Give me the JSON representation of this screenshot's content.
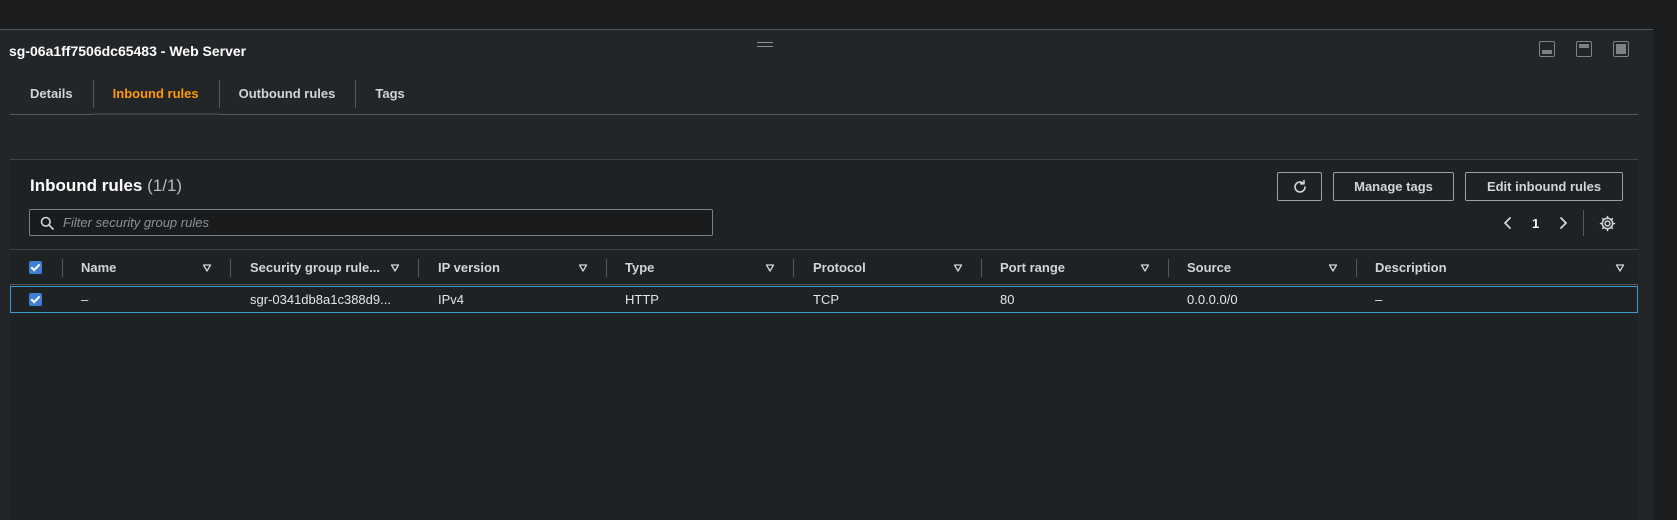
{
  "page": {
    "security_group_title": "sg-06a1ff7506dc65483 - Web Server"
  },
  "tabs": [
    {
      "label": "Details",
      "active": false
    },
    {
      "label": "Inbound rules",
      "active": true
    },
    {
      "label": "Outbound rules",
      "active": false
    },
    {
      "label": "Tags",
      "active": false
    }
  ],
  "inbound": {
    "title": "Inbound rules",
    "count": "(1/1)",
    "buttons": {
      "manage_tags": "Manage tags",
      "edit_inbound_rules": "Edit inbound rules"
    },
    "filter": {
      "placeholder": "Filter security group rules",
      "value": ""
    },
    "pagination": {
      "current_page": "1"
    },
    "table": {
      "headers": [
        "Name",
        "Security group rule...",
        "IP version",
        "Type",
        "Protocol",
        "Port range",
        "Source",
        "Description"
      ],
      "rows": [
        {
          "selected": true,
          "name": "–",
          "rule_id": "sgr-0341db8a1c388d9...",
          "ip_version": "IPv4",
          "type": "HTTP",
          "protocol": "TCP",
          "port_range": "80",
          "source": "0.0.0.0/0",
          "description": "–"
        }
      ]
    }
  },
  "icons": {
    "panel_controls": [
      "panel-bottom-icon",
      "panel-side-icon",
      "panel-full-icon"
    ],
    "refresh": "refresh-icon",
    "search": "search-icon",
    "settings": "gear-icon"
  },
  "colors": {
    "background": "#1b1d1f",
    "panel": "#232629",
    "active_tab": "#ff9900",
    "selection_border": "#3d9bd3",
    "checkbox": "#3d7fd3"
  }
}
